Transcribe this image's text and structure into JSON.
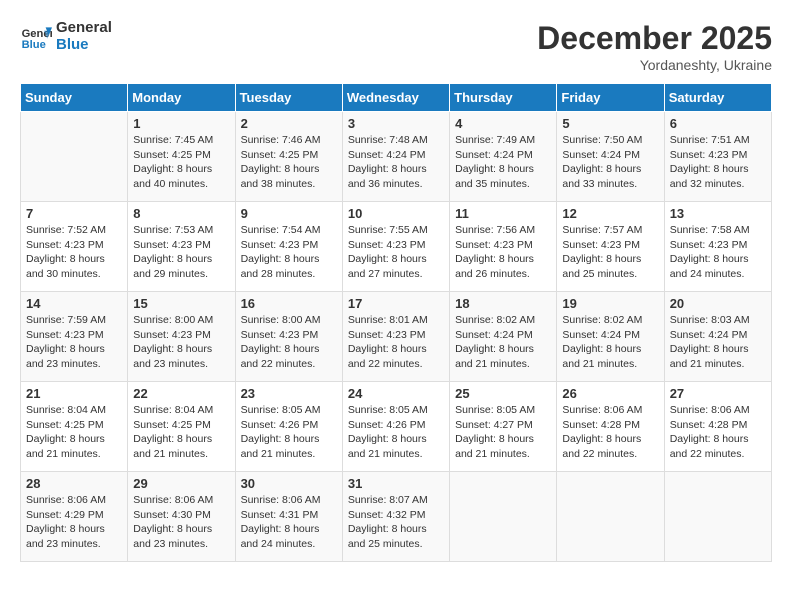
{
  "logo": {
    "line1": "General",
    "line2": "Blue"
  },
  "title": "December 2025",
  "subtitle": "Yordaneshty, Ukraine",
  "days_of_week": [
    "Sunday",
    "Monday",
    "Tuesday",
    "Wednesday",
    "Thursday",
    "Friday",
    "Saturday"
  ],
  "weeks": [
    [
      {
        "day": null,
        "sunrise": null,
        "sunset": null,
        "daylight": null
      },
      {
        "day": "1",
        "sunrise": "Sunrise: 7:45 AM",
        "sunset": "Sunset: 4:25 PM",
        "daylight": "Daylight: 8 hours and 40 minutes."
      },
      {
        "day": "2",
        "sunrise": "Sunrise: 7:46 AM",
        "sunset": "Sunset: 4:25 PM",
        "daylight": "Daylight: 8 hours and 38 minutes."
      },
      {
        "day": "3",
        "sunrise": "Sunrise: 7:48 AM",
        "sunset": "Sunset: 4:24 PM",
        "daylight": "Daylight: 8 hours and 36 minutes."
      },
      {
        "day": "4",
        "sunrise": "Sunrise: 7:49 AM",
        "sunset": "Sunset: 4:24 PM",
        "daylight": "Daylight: 8 hours and 35 minutes."
      },
      {
        "day": "5",
        "sunrise": "Sunrise: 7:50 AM",
        "sunset": "Sunset: 4:24 PM",
        "daylight": "Daylight: 8 hours and 33 minutes."
      },
      {
        "day": "6",
        "sunrise": "Sunrise: 7:51 AM",
        "sunset": "Sunset: 4:23 PM",
        "daylight": "Daylight: 8 hours and 32 minutes."
      }
    ],
    [
      {
        "day": "7",
        "sunrise": "Sunrise: 7:52 AM",
        "sunset": "Sunset: 4:23 PM",
        "daylight": "Daylight: 8 hours and 30 minutes."
      },
      {
        "day": "8",
        "sunrise": "Sunrise: 7:53 AM",
        "sunset": "Sunset: 4:23 PM",
        "daylight": "Daylight: 8 hours and 29 minutes."
      },
      {
        "day": "9",
        "sunrise": "Sunrise: 7:54 AM",
        "sunset": "Sunset: 4:23 PM",
        "daylight": "Daylight: 8 hours and 28 minutes."
      },
      {
        "day": "10",
        "sunrise": "Sunrise: 7:55 AM",
        "sunset": "Sunset: 4:23 PM",
        "daylight": "Daylight: 8 hours and 27 minutes."
      },
      {
        "day": "11",
        "sunrise": "Sunrise: 7:56 AM",
        "sunset": "Sunset: 4:23 PM",
        "daylight": "Daylight: 8 hours and 26 minutes."
      },
      {
        "day": "12",
        "sunrise": "Sunrise: 7:57 AM",
        "sunset": "Sunset: 4:23 PM",
        "daylight": "Daylight: 8 hours and 25 minutes."
      },
      {
        "day": "13",
        "sunrise": "Sunrise: 7:58 AM",
        "sunset": "Sunset: 4:23 PM",
        "daylight": "Daylight: 8 hours and 24 minutes."
      }
    ],
    [
      {
        "day": "14",
        "sunrise": "Sunrise: 7:59 AM",
        "sunset": "Sunset: 4:23 PM",
        "daylight": "Daylight: 8 hours and 23 minutes."
      },
      {
        "day": "15",
        "sunrise": "Sunrise: 8:00 AM",
        "sunset": "Sunset: 4:23 PM",
        "daylight": "Daylight: 8 hours and 23 minutes."
      },
      {
        "day": "16",
        "sunrise": "Sunrise: 8:00 AM",
        "sunset": "Sunset: 4:23 PM",
        "daylight": "Daylight: 8 hours and 22 minutes."
      },
      {
        "day": "17",
        "sunrise": "Sunrise: 8:01 AM",
        "sunset": "Sunset: 4:23 PM",
        "daylight": "Daylight: 8 hours and 22 minutes."
      },
      {
        "day": "18",
        "sunrise": "Sunrise: 8:02 AM",
        "sunset": "Sunset: 4:24 PM",
        "daylight": "Daylight: 8 hours and 21 minutes."
      },
      {
        "day": "19",
        "sunrise": "Sunrise: 8:02 AM",
        "sunset": "Sunset: 4:24 PM",
        "daylight": "Daylight: 8 hours and 21 minutes."
      },
      {
        "day": "20",
        "sunrise": "Sunrise: 8:03 AM",
        "sunset": "Sunset: 4:24 PM",
        "daylight": "Daylight: 8 hours and 21 minutes."
      }
    ],
    [
      {
        "day": "21",
        "sunrise": "Sunrise: 8:04 AM",
        "sunset": "Sunset: 4:25 PM",
        "daylight": "Daylight: 8 hours and 21 minutes."
      },
      {
        "day": "22",
        "sunrise": "Sunrise: 8:04 AM",
        "sunset": "Sunset: 4:25 PM",
        "daylight": "Daylight: 8 hours and 21 minutes."
      },
      {
        "day": "23",
        "sunrise": "Sunrise: 8:05 AM",
        "sunset": "Sunset: 4:26 PM",
        "daylight": "Daylight: 8 hours and 21 minutes."
      },
      {
        "day": "24",
        "sunrise": "Sunrise: 8:05 AM",
        "sunset": "Sunset: 4:26 PM",
        "daylight": "Daylight: 8 hours and 21 minutes."
      },
      {
        "day": "25",
        "sunrise": "Sunrise: 8:05 AM",
        "sunset": "Sunset: 4:27 PM",
        "daylight": "Daylight: 8 hours and 21 minutes."
      },
      {
        "day": "26",
        "sunrise": "Sunrise: 8:06 AM",
        "sunset": "Sunset: 4:28 PM",
        "daylight": "Daylight: 8 hours and 22 minutes."
      },
      {
        "day": "27",
        "sunrise": "Sunrise: 8:06 AM",
        "sunset": "Sunset: 4:28 PM",
        "daylight": "Daylight: 8 hours and 22 minutes."
      }
    ],
    [
      {
        "day": "28",
        "sunrise": "Sunrise: 8:06 AM",
        "sunset": "Sunset: 4:29 PM",
        "daylight": "Daylight: 8 hours and 23 minutes."
      },
      {
        "day": "29",
        "sunrise": "Sunrise: 8:06 AM",
        "sunset": "Sunset: 4:30 PM",
        "daylight": "Daylight: 8 hours and 23 minutes."
      },
      {
        "day": "30",
        "sunrise": "Sunrise: 8:06 AM",
        "sunset": "Sunset: 4:31 PM",
        "daylight": "Daylight: 8 hours and 24 minutes."
      },
      {
        "day": "31",
        "sunrise": "Sunrise: 8:07 AM",
        "sunset": "Sunset: 4:32 PM",
        "daylight": "Daylight: 8 hours and 25 minutes."
      },
      {
        "day": null,
        "sunrise": null,
        "sunset": null,
        "daylight": null
      },
      {
        "day": null,
        "sunrise": null,
        "sunset": null,
        "daylight": null
      },
      {
        "day": null,
        "sunrise": null,
        "sunset": null,
        "daylight": null
      }
    ]
  ]
}
